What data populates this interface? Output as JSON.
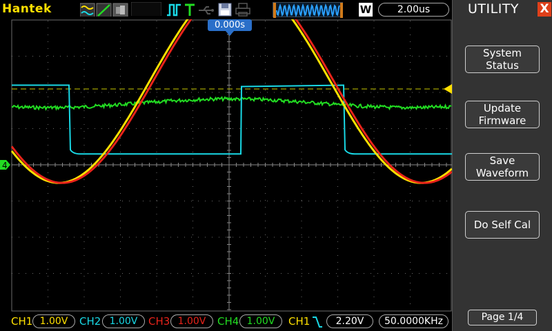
{
  "brand": "Hantek",
  "timebase": "2.00us",
  "acq_mode_label": "W",
  "trigger_position": "0.000s",
  "ground_marker_label": "4",
  "channels": [
    {
      "name": "CH1",
      "scale": "1.00V",
      "color": "#ffe000"
    },
    {
      "name": "CH2",
      "scale": "1.00V",
      "color": "#19d9e6"
    },
    {
      "name": "CH3",
      "scale": "1.00V",
      "color": "#e8231a"
    },
    {
      "name": "CH4",
      "scale": "1.00V",
      "color": "#22dd22"
    }
  ],
  "trigger": {
    "source": "CH1",
    "level": "2.20V",
    "frequency": "50.0000KHz"
  },
  "menu": {
    "title": "UTILITY",
    "close_label": "X",
    "buttons": [
      "System\nStatus",
      "Update\nFirmware",
      "Save\nWaveform",
      "Do Self Cal"
    ],
    "page": "Page 1/4"
  },
  "colors": {
    "grid": "#6b6b6b",
    "trigger_level": "#c8c800",
    "menu_bg": "#333333",
    "trigger_badge": "#2a6fc9"
  },
  "icons": [
    "waveform-icon",
    "line-display-icon",
    "persist-icon",
    "blank-icon",
    "pulse-trigger-icon",
    "trigger-t-icon",
    "usb-icon",
    "save-icon",
    "print-icon"
  ],
  "chart_data": {
    "type": "line",
    "title": "",
    "xlabel": "",
    "ylabel": "",
    "grid": true,
    "x_divisions": 12,
    "y_divisions": 8,
    "xlim_us": [
      -12,
      12
    ],
    "ylim_div": [
      -4,
      4
    ],
    "series": [
      {
        "name": "CH1",
        "shape": "sine",
        "frequency_khz": 50,
        "amplitude_div": 2.8,
        "offset_div": 2.3
      },
      {
        "name": "CH2",
        "shape": "square",
        "frequency_khz": 50,
        "high_div": 2.2,
        "low_div": 0.3
      },
      {
        "name": "CH3",
        "shape": "sine",
        "frequency_khz": 50,
        "amplitude_div": 2.8,
        "offset_div": 2.3
      },
      {
        "name": "CH4",
        "shape": "flat-noise",
        "level_div": 1.7
      }
    ]
  }
}
